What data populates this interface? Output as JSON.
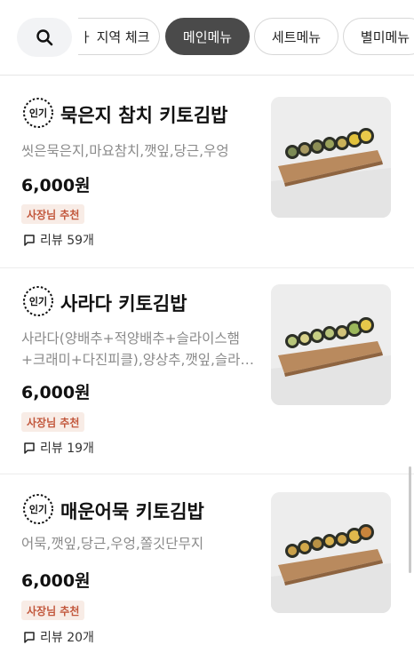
{
  "categories": {
    "partial_label": "ㅏ 지역 체크",
    "items": [
      {
        "label": "메인메뉴",
        "active": true
      },
      {
        "label": "세트메뉴",
        "active": false
      },
      {
        "label": "별미메뉴",
        "active": false
      }
    ]
  },
  "menu": [
    {
      "badge": "인기",
      "name": "묵은지 참치 키토김밥",
      "description": "씻은묵은지,마요참치,깻잎,당근,우엉",
      "price": "6,000원",
      "tag": "사장님 추천",
      "review": "리뷰 59개"
    },
    {
      "badge": "인기",
      "name": "사라다 키토김밥",
      "description": "사라다(양배추+적양배추+슬라이스햄+크래미+다진피클),양상추,깻잎,슬라…",
      "price": "6,000원",
      "tag": "사장님 추천",
      "review": "리뷰 19개"
    },
    {
      "badge": "인기",
      "name": "매운어묵 키토김밥",
      "description": "어묵,깻잎,당근,우엉,쫄깃단무지",
      "price": "6,000원",
      "tag": "사장님 추천",
      "review": "리뷰 20개"
    }
  ]
}
